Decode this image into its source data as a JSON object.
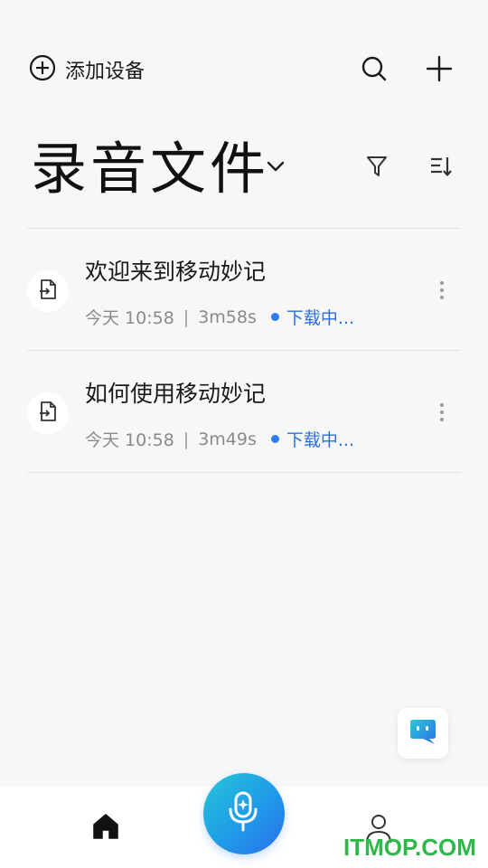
{
  "header": {
    "add_device_label": "添加设备",
    "page_title": "录音文件"
  },
  "recordings": [
    {
      "title": "欢迎来到移动妙记",
      "date": "今天 10:58",
      "separator": "|",
      "duration": "3m58s",
      "status": "下载中..."
    },
    {
      "title": "如何使用移动妙记",
      "date": "今天 10:58",
      "separator": "|",
      "duration": "3m49s",
      "status": "下载中..."
    }
  ],
  "icons": {
    "add_device": "plus-circle-icon",
    "search": "search-icon",
    "add": "plus-icon",
    "title_dropdown": "chevron-down-icon",
    "filter": "filter-icon",
    "sort": "sort-icon",
    "file": "file-import-icon",
    "more": "more-vertical-icon",
    "assistant": "assistant-icon",
    "mic": "mic-sparkle-icon",
    "home": "home-icon",
    "profile": "user-icon"
  },
  "colors": {
    "accent": "#2b6fe0",
    "status_dot": "#2b7df0",
    "mic_gradient_start": "#27c7d8",
    "mic_gradient_end": "#2a6ee8",
    "watermark": "#2fb84a"
  },
  "watermark": "ITMOP.COM"
}
